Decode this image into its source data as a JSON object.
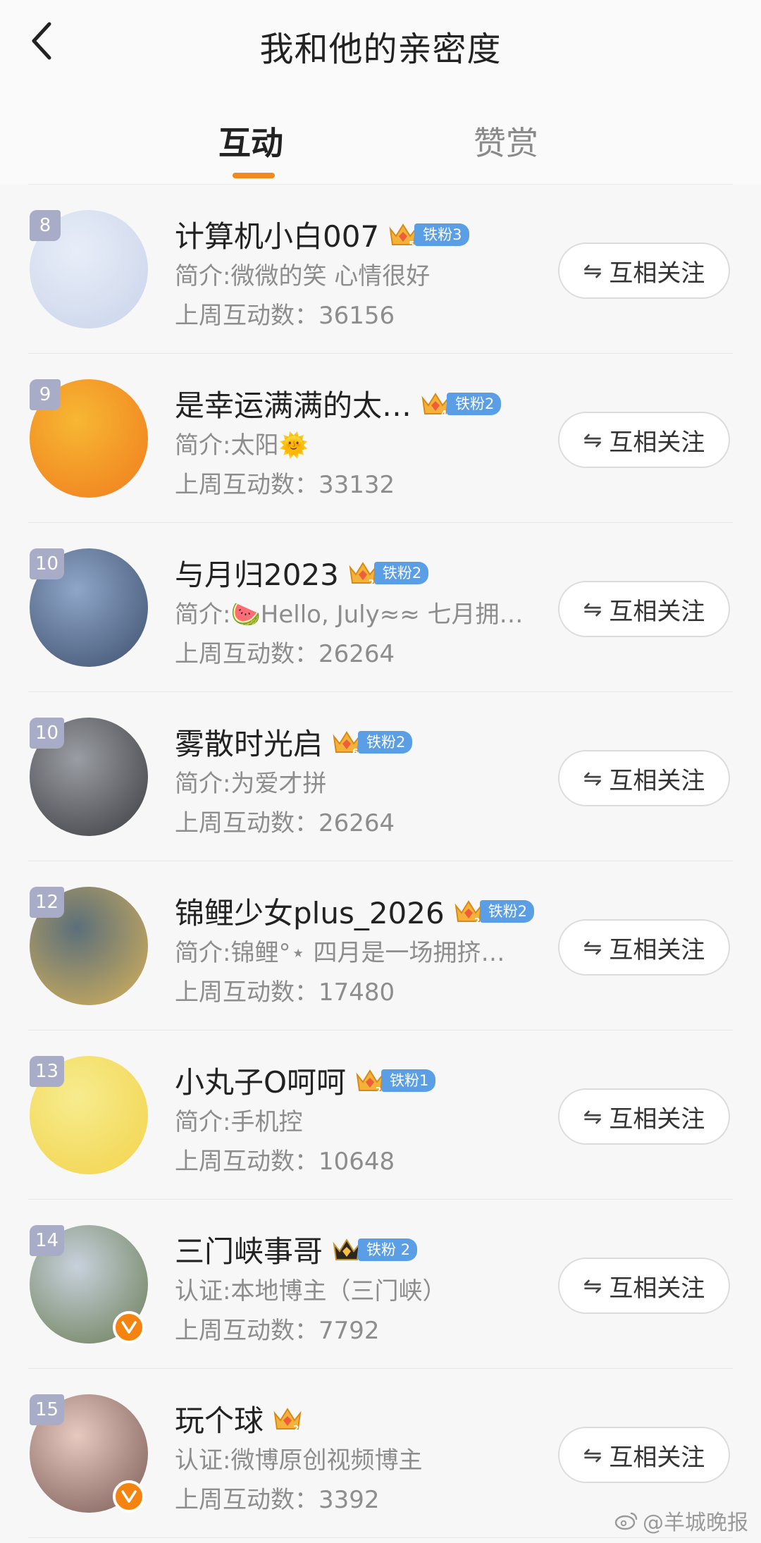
{
  "header": {
    "title": "我和他的亲密度"
  },
  "tabs": [
    {
      "label": "互动",
      "active": true
    },
    {
      "label": "赞赏",
      "active": false
    }
  ],
  "colors": {
    "accent": "#f28a1b",
    "fan_tag": "#5a9fe6",
    "rank_badge": "#a9acc7",
    "verified": "#f5830f"
  },
  "users": [
    {
      "rank": "8",
      "name": "计算机小白007",
      "crown_level": "5",
      "fan_tag": "铁粉3",
      "intro": "简介:微微的笑 心情很好",
      "weekly": "上周互动数：36156",
      "follow": "互相关注",
      "verified": false,
      "avatar_colors": [
        "#e8eef8",
        "#c9d3ea"
      ]
    },
    {
      "rank": "9",
      "name": "是幸运满满的太…",
      "crown_level": "4",
      "fan_tag": "铁粉2",
      "intro": "简介:太阳🌞",
      "weekly": "上周互动数：33132",
      "follow": "互相关注",
      "verified": false,
      "avatar_colors": [
        "#f7b733",
        "#f07c1e"
      ]
    },
    {
      "rank": "10",
      "name": "与月归2023",
      "crown_level": "2",
      "fan_tag": "铁粉2",
      "intro": "简介:🍉Hello, July≈≈ 七月拥…",
      "weekly": "上周互动数：26264",
      "follow": "互相关注",
      "verified": false,
      "avatar_colors": [
        "#8fa6c8",
        "#3d4f6e"
      ]
    },
    {
      "rank": "10",
      "name": "雾散时光启",
      "crown_level": "6",
      "fan_tag": "铁粉2",
      "intro": "简介:为爱才拼",
      "weekly": "上周互动数：26264",
      "follow": "互相关注",
      "verified": false,
      "avatar_colors": [
        "#9a9da3",
        "#3b3c40"
      ]
    },
    {
      "rank": "12",
      "name": "锦鲤少女plus_2026",
      "crown_level": "2",
      "fan_tag": "铁粉2",
      "intro": "简介:锦鲤°⋆ 四月是一场拥挤…",
      "weekly": "上周互动数：17480",
      "follow": "互相关注",
      "verified": false,
      "avatar_colors": [
        "#5c6f7a",
        "#d7b25a"
      ]
    },
    {
      "rank": "13",
      "name": "小丸子O呵呵",
      "crown_level": "2",
      "fan_tag": "铁粉1",
      "intro": "简介:手机控",
      "weekly": "上周互动数：10648",
      "follow": "互相关注",
      "verified": false,
      "avatar_colors": [
        "#f6ec8e",
        "#f3d34b"
      ]
    },
    {
      "rank": "14",
      "name": "三门峡事哥",
      "crown_level": "",
      "fan_tag": "铁粉 2",
      "intro": "认证:本地博主（三门峡）",
      "weekly": "上周互动数：7792",
      "follow": "互相关注",
      "verified": true,
      "avatar_colors": [
        "#c8d1dc",
        "#6a7c55"
      ]
    },
    {
      "rank": "15",
      "name": "玩个球",
      "crown_level": "2",
      "fan_tag": "",
      "intro": "认证:微博原创视频博主",
      "weekly": "上周互动数：3392",
      "follow": "互相关注",
      "verified": true,
      "avatar_colors": [
        "#e7c9c0",
        "#7a5a55"
      ]
    }
  ],
  "watermark": "@羊城晚报"
}
